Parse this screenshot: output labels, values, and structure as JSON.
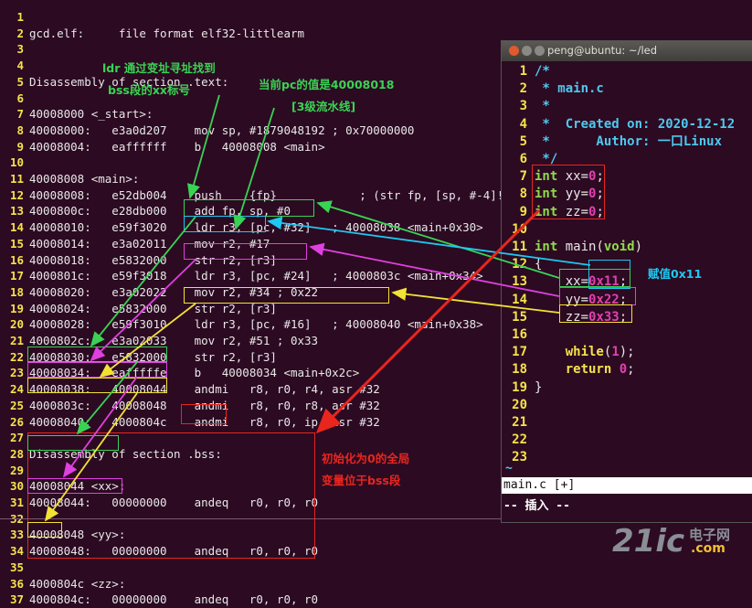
{
  "terminal": {
    "lines": [
      {
        "n": "1",
        "t": ""
      },
      {
        "n": "2",
        "t": "gcd.elf:     file format elf32-littlearm"
      },
      {
        "n": "3",
        "t": ""
      },
      {
        "n": "4",
        "t": ""
      },
      {
        "n": "5",
        "t": "Disassembly of section .text:"
      },
      {
        "n": "6",
        "t": ""
      },
      {
        "n": "7",
        "t": "40008000 <_start>:"
      },
      {
        "n": "8",
        "t": "40008000:   e3a0d207    mov sp, #1879048192 ; 0x70000000"
      },
      {
        "n": "9",
        "t": "40008004:   eaffffff    b   40008008 <main>"
      },
      {
        "n": "10",
        "t": ""
      },
      {
        "n": "11",
        "t": "40008008 <main>:"
      },
      {
        "n": "12",
        "t": "40008008:   e52db004    push    {fp}            ; (str fp, [sp, #-4]!)"
      },
      {
        "n": "13",
        "t": "4000800c:   e28db000    add fp, sp, #0"
      },
      {
        "n": "14",
        "t": "40008010:   e59f3020    ldr r3, [pc, #32]   ; 40008038 <main+0x30>"
      },
      {
        "n": "15",
        "t": "40008014:   e3a02011    mov r2, #17"
      },
      {
        "n": "16",
        "t": "40008018:   e5832000    str r2, [r3]"
      },
      {
        "n": "17",
        "t": "4000801c:   e59f3018    ldr r3, [pc, #24]   ; 4000803c <main+0x34>"
      },
      {
        "n": "18",
        "t": "40008020:   e3a02022    mov r2, #34 ; 0x22"
      },
      {
        "n": "19",
        "t": "40008024:   e5832000    str r2, [r3]"
      },
      {
        "n": "20",
        "t": "40008028:   e59f3010    ldr r3, [pc, #16]   ; 40008040 <main+0x38>"
      },
      {
        "n": "21",
        "t": "4000802c:   e3a02033    mov r2, #51 ; 0x33"
      },
      {
        "n": "22",
        "t": "40008030:   e5832000    str r2, [r3]"
      },
      {
        "n": "23",
        "t": "40008034:   eafffffe    b   40008034 <main+0x2c>"
      },
      {
        "n": "24",
        "t": "40008038:   40008044    andmi   r8, r0, r4, asr #32"
      },
      {
        "n": "25",
        "t": "4000803c:   40008048    andmi   r8, r0, r8, asr #32"
      },
      {
        "n": "26",
        "t": "40008040:   4000804c    andmi   r8, r0, ip, asr #32"
      },
      {
        "n": "27",
        "t": ""
      },
      {
        "n": "28",
        "t": "Disassembly of section .bss:"
      },
      {
        "n": "29",
        "t": ""
      },
      {
        "n": "30",
        "t": "40008044 <xx>:"
      },
      {
        "n": "31",
        "t": "40008044:   00000000    andeq   r0, r0, r0"
      },
      {
        "n": "32",
        "t": ""
      },
      {
        "n": "33",
        "t": "40008048 <yy>:"
      },
      {
        "n": "34",
        "t": "40008048:   00000000    andeq   r0, r0, r0"
      },
      {
        "n": "35",
        "t": ""
      },
      {
        "n": "36",
        "t": "4000804c <zz>:"
      },
      {
        "n": "37",
        "t": "4000804c:   00000000    andeq   r0, r0, r0"
      }
    ]
  },
  "annotations": {
    "ldr_note_1": "ldr 通过变址寻址找到",
    "ldr_note_2": "bss段的xx标号",
    "pc_note": "当前pc的值是40008018",
    "pipeline_note": "[3级流水线]",
    "bss_note_1": "初始化为0的全局",
    "bss_note_2": "变量位于bss段",
    "assign_note": "赋值0x11"
  },
  "vim": {
    "title": "peng@ubuntu: ~/led",
    "status": "main.c [+]",
    "mode": "-- 插入 --",
    "tilde": "~",
    "lines": [
      {
        "n": "1",
        "parts": [
          {
            "c": "cm",
            "t": "/*"
          }
        ]
      },
      {
        "n": "2",
        "parts": [
          {
            "c": "cm",
            "t": " * main.c"
          }
        ]
      },
      {
        "n": "3",
        "parts": [
          {
            "c": "cm",
            "t": " *"
          }
        ]
      },
      {
        "n": "4",
        "parts": [
          {
            "c": "cm",
            "t": " *  Created on: 2020-12-12"
          }
        ]
      },
      {
        "n": "5",
        "parts": [
          {
            "c": "cm",
            "t": " *      Author: 一口Linux"
          }
        ]
      },
      {
        "n": "6",
        "parts": [
          {
            "c": "cm",
            "t": " */"
          }
        ]
      },
      {
        "n": "7",
        "parts": [
          {
            "c": "ty",
            "t": "int"
          },
          {
            "c": "pl",
            "t": " xx="
          },
          {
            "c": "nm",
            "t": "0"
          },
          {
            "c": "pl",
            "t": ";"
          }
        ]
      },
      {
        "n": "8",
        "parts": [
          {
            "c": "ty",
            "t": "int"
          },
          {
            "c": "pl",
            "t": " yy="
          },
          {
            "c": "nm",
            "t": "0"
          },
          {
            "c": "pl",
            "t": ";"
          }
        ]
      },
      {
        "n": "9",
        "parts": [
          {
            "c": "ty",
            "t": "int"
          },
          {
            "c": "pl",
            "t": " zz="
          },
          {
            "c": "nm",
            "t": "0"
          },
          {
            "c": "pl",
            "t": ";"
          }
        ]
      },
      {
        "n": "10",
        "parts": []
      },
      {
        "n": "11",
        "parts": [
          {
            "c": "ty",
            "t": "int"
          },
          {
            "c": "pl",
            "t": " main("
          },
          {
            "c": "ty",
            "t": "void"
          },
          {
            "c": "pl",
            "t": ")"
          }
        ]
      },
      {
        "n": "12",
        "parts": [
          {
            "c": "pl",
            "t": "{"
          }
        ]
      },
      {
        "n": "13",
        "parts": [
          {
            "c": "pl",
            "t": "    xx="
          },
          {
            "c": "nm",
            "t": "0x11"
          },
          {
            "c": "pl",
            "t": ";"
          }
        ]
      },
      {
        "n": "14",
        "parts": [
          {
            "c": "pl",
            "t": "    yy="
          },
          {
            "c": "nm",
            "t": "0x22"
          },
          {
            "c": "pl",
            "t": ";"
          }
        ]
      },
      {
        "n": "15",
        "parts": [
          {
            "c": "pl",
            "t": "    zz="
          },
          {
            "c": "nm",
            "t": "0x33"
          },
          {
            "c": "pl",
            "t": ";"
          }
        ]
      },
      {
        "n": "16",
        "parts": []
      },
      {
        "n": "17",
        "parts": [
          {
            "c": "pl",
            "t": "    "
          },
          {
            "c": "kw",
            "t": "while"
          },
          {
            "c": "pl",
            "t": "("
          },
          {
            "c": "nm",
            "t": "1"
          },
          {
            "c": "pl",
            "t": ");"
          }
        ]
      },
      {
        "n": "18",
        "parts": [
          {
            "c": "pl",
            "t": "    "
          },
          {
            "c": "kw",
            "t": "return"
          },
          {
            "c": "pl",
            "t": " "
          },
          {
            "c": "nm",
            "t": "0"
          },
          {
            "c": "pl",
            "t": ";"
          }
        ]
      },
      {
        "n": "19",
        "parts": [
          {
            "c": "pl",
            "t": "}"
          }
        ]
      },
      {
        "n": "20",
        "parts": []
      },
      {
        "n": "21",
        "parts": []
      },
      {
        "n": "22",
        "parts": []
      },
      {
        "n": "23",
        "parts": []
      }
    ]
  },
  "watermark": {
    "main": "21ic",
    "sub": "电子网",
    "domain": ".com"
  },
  "colors": {
    "green": "#39d353",
    "cyan": "#1ec8f0",
    "magenta": "#e040e0",
    "yellow": "#f2e233",
    "red": "#e8261e"
  },
  "icons": {
    "close": "close-icon",
    "minimize": "minimize-icon",
    "maximize": "maximize-icon"
  }
}
